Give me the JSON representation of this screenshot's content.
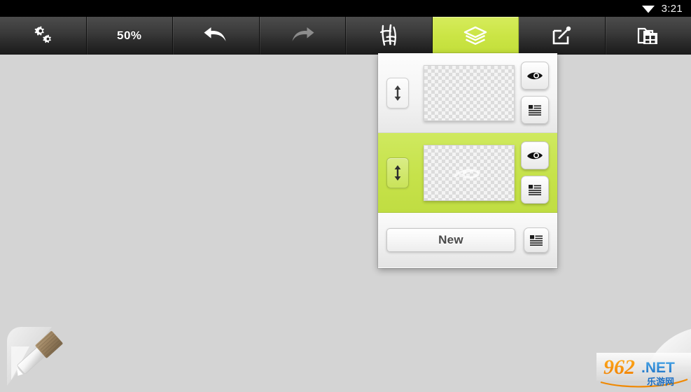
{
  "status_bar": {
    "wifi_icon": "wifi-icon",
    "time": "3:21"
  },
  "toolbar": {
    "buttons": [
      {
        "name": "settings-button",
        "icon": "gears-icon",
        "label": ""
      },
      {
        "name": "zoom-button",
        "icon": "zoom-level-text",
        "label": "50%"
      },
      {
        "name": "undo-button",
        "icon": "undo-arrow-icon",
        "label": ""
      },
      {
        "name": "redo-button",
        "icon": "redo-arrow-icon",
        "label": ""
      },
      {
        "name": "brush-button",
        "icon": "calligraphy-brush-icon",
        "label": ""
      },
      {
        "name": "layers-button",
        "icon": "layers-stack-icon",
        "label": ""
      },
      {
        "name": "share-button",
        "icon": "share-export-icon",
        "label": ""
      },
      {
        "name": "gallery-button",
        "icon": "gallery-folder-icon",
        "label": ""
      }
    ],
    "active_button": "layers-button",
    "disabled_button": "redo-button",
    "active_color": "#cbe545"
  },
  "canvas": {
    "background_color": "#d4d4d4",
    "brush_tool_icon": "paintbrush-tool-icon"
  },
  "layers_panel": {
    "layers": [
      {
        "name": "layer-row-1",
        "selected": false,
        "thumbnail": "transparent-checkerboard",
        "has_content": false,
        "reorder_icon": "vertical-arrows-icon",
        "visibility_icon": "eye-icon",
        "menu_icon": "layer-menu-icon"
      },
      {
        "name": "layer-row-2",
        "selected": true,
        "thumbnail": "transparent-checkerboard",
        "has_content": true,
        "reorder_icon": "vertical-arrows-icon",
        "visibility_icon": "eye-icon",
        "menu_icon": "layer-menu-icon"
      }
    ],
    "footer": {
      "new_label": "New",
      "menu_icon": "panel-menu-icon"
    },
    "selected_color": "#c6e24a"
  },
  "watermark": {
    "text": "962.NET",
    "subtext": "乐游网"
  }
}
